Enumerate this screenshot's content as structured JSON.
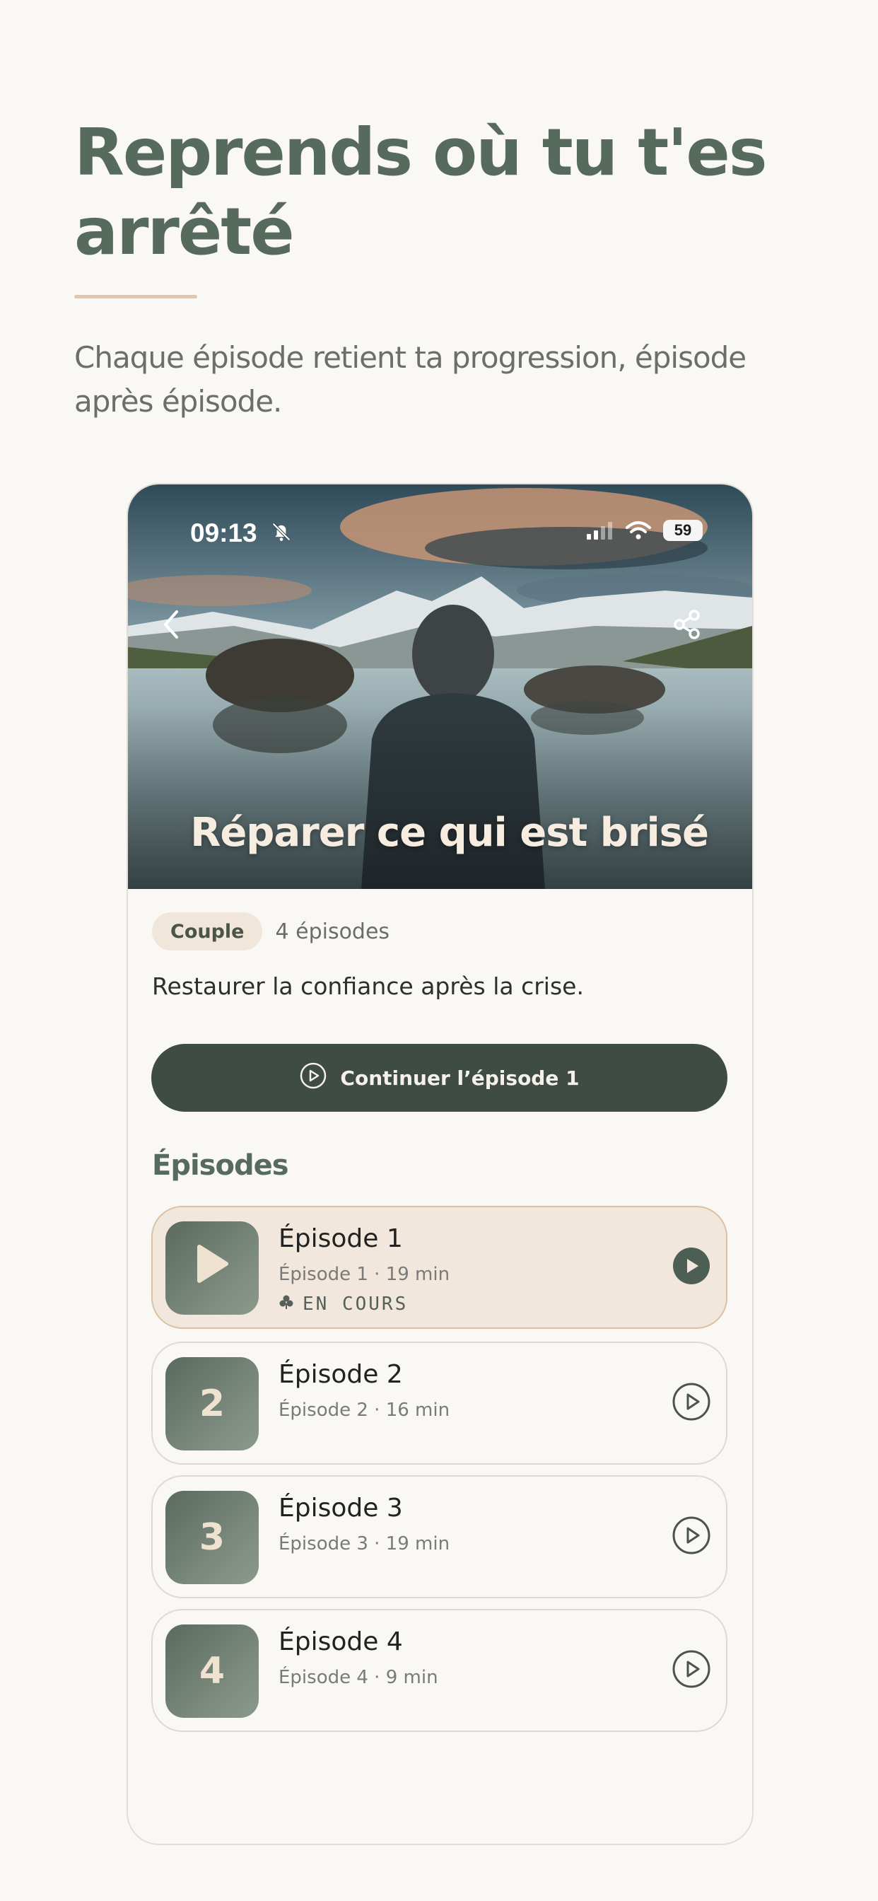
{
  "headline": "Reprends où tu t'es arrêté",
  "subtitle": "Chaque épisode retient ta progression, épisode après épisode.",
  "status_bar": {
    "time": "09:13",
    "battery": "59"
  },
  "hero": {
    "title": "Réparer ce qui est brisé"
  },
  "program": {
    "tag": "Couple",
    "episode_count": "4 épisodes",
    "description": "Restaurer la confiance après la crise.",
    "continue_label": "Continuer l’épisode 1"
  },
  "episodes_section_title": "Épisodes",
  "episodes": [
    {
      "thumb": "",
      "title": "Épisode 1",
      "subtitle": "Épisode 1 · 19 min",
      "status": "EN COURS",
      "active": true
    },
    {
      "thumb": "2",
      "title": "Épisode 2",
      "subtitle": "Épisode 2 · 16 min",
      "status": "",
      "active": false
    },
    {
      "thumb": "3",
      "title": "Épisode 3",
      "subtitle": "Épisode 3 · 19 min",
      "status": "",
      "active": false
    },
    {
      "thumb": "4",
      "title": "Épisode 4",
      "subtitle": "Épisode 4 · 9 min",
      "status": "",
      "active": false
    }
  ],
  "colors": {
    "accent": "#566b5d",
    "button": "#3f4c45",
    "tag_bg": "#f1e6da"
  }
}
